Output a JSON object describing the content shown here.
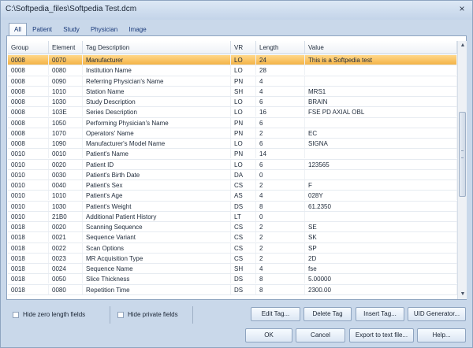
{
  "window": {
    "title": "C:\\Softpedia_files\\Softpedia Test.dcm",
    "close_glyph": "×"
  },
  "tabs": [
    {
      "label": "All",
      "active": true
    },
    {
      "label": "Patient",
      "active": false
    },
    {
      "label": "Study",
      "active": false
    },
    {
      "label": "Physician",
      "active": false
    },
    {
      "label": "Image",
      "active": false
    }
  ],
  "table": {
    "columns": {
      "group": "Group",
      "element": "Element",
      "desc": "Tag Description",
      "vr": "VR",
      "length": "Length",
      "value": "Value"
    },
    "selected_index": 0,
    "rows": [
      {
        "group": "0008",
        "element": "0070",
        "desc": "Manufacturer",
        "vr": "LO",
        "length": "24",
        "value": "This is a Softpedia test"
      },
      {
        "group": "0008",
        "element": "0080",
        "desc": "Institution Name",
        "vr": "LO",
        "length": "28",
        "value": ""
      },
      {
        "group": "0008",
        "element": "0090",
        "desc": "Referring Physician's Name",
        "vr": "PN",
        "length": "4",
        "value": ""
      },
      {
        "group": "0008",
        "element": "1010",
        "desc": "Station Name",
        "vr": "SH",
        "length": "4",
        "value": "MRS1"
      },
      {
        "group": "0008",
        "element": "1030",
        "desc": "Study Description",
        "vr": "LO",
        "length": "6",
        "value": "BRAIN"
      },
      {
        "group": "0008",
        "element": "103E",
        "desc": "Series Description",
        "vr": "LO",
        "length": "16",
        "value": "FSE PD AXIAL OBL"
      },
      {
        "group": "0008",
        "element": "1050",
        "desc": "Performing Physician's Name",
        "vr": "PN",
        "length": "6",
        "value": ""
      },
      {
        "group": "0008",
        "element": "1070",
        "desc": "Operators' Name",
        "vr": "PN",
        "length": "2",
        "value": "EC"
      },
      {
        "group": "0008",
        "element": "1090",
        "desc": "Manufacturer's Model Name",
        "vr": "LO",
        "length": "6",
        "value": "SIGNA"
      },
      {
        "group": "0010",
        "element": "0010",
        "desc": "Patient's Name",
        "vr": "PN",
        "length": "14",
        "value": ""
      },
      {
        "group": "0010",
        "element": "0020",
        "desc": "Patient ID",
        "vr": "LO",
        "length": "6",
        "value": "123565"
      },
      {
        "group": "0010",
        "element": "0030",
        "desc": "Patient's Birth Date",
        "vr": "DA",
        "length": "0",
        "value": ""
      },
      {
        "group": "0010",
        "element": "0040",
        "desc": "Patient's Sex",
        "vr": "CS",
        "length": "2",
        "value": "F"
      },
      {
        "group": "0010",
        "element": "1010",
        "desc": "Patient's Age",
        "vr": "AS",
        "length": "4",
        "value": "028Y"
      },
      {
        "group": "0010",
        "element": "1030",
        "desc": "Patient's Weight",
        "vr": "DS",
        "length": "8",
        "value": "61.2350"
      },
      {
        "group": "0010",
        "element": "21B0",
        "desc": "Additional Patient History",
        "vr": "LT",
        "length": "0",
        "value": ""
      },
      {
        "group": "0018",
        "element": "0020",
        "desc": "Scanning Sequence",
        "vr": "CS",
        "length": "2",
        "value": "SE"
      },
      {
        "group": "0018",
        "element": "0021",
        "desc": "Sequence Variant",
        "vr": "CS",
        "length": "2",
        "value": "SK"
      },
      {
        "group": "0018",
        "element": "0022",
        "desc": "Scan Options",
        "vr": "CS",
        "length": "2",
        "value": "SP"
      },
      {
        "group": "0018",
        "element": "0023",
        "desc": "MR Acquisition Type",
        "vr": "CS",
        "length": "2",
        "value": "2D"
      },
      {
        "group": "0018",
        "element": "0024",
        "desc": "Sequence Name",
        "vr": "SH",
        "length": "4",
        "value": "fse"
      },
      {
        "group": "0018",
        "element": "0050",
        "desc": "Slice Thickness",
        "vr": "DS",
        "length": "8",
        "value": "5.00000"
      },
      {
        "group": "0018",
        "element": "0080",
        "desc": "Repetition Time",
        "vr": "DS",
        "length": "8",
        "value": "2300.00"
      }
    ]
  },
  "options": {
    "hide_zero_length": {
      "label": "Hide zero length fields",
      "checked": false
    },
    "hide_private": {
      "label": "Hide private fields",
      "checked": false
    }
  },
  "buttons": {
    "edit_tag": "Edit Tag...",
    "delete_tag": "Delete Tag",
    "insert_tag": "Insert Tag...",
    "uid_generator": "UID Generator...",
    "ok": "OK",
    "cancel": "Cancel",
    "export": "Export to text file...",
    "help": "Help..."
  },
  "scrollbar": {
    "up_glyph": "▲",
    "down_glyph": "▼"
  },
  "colors": {
    "selected_row": "#f4b347",
    "window_bg": "#c9d8ea"
  }
}
